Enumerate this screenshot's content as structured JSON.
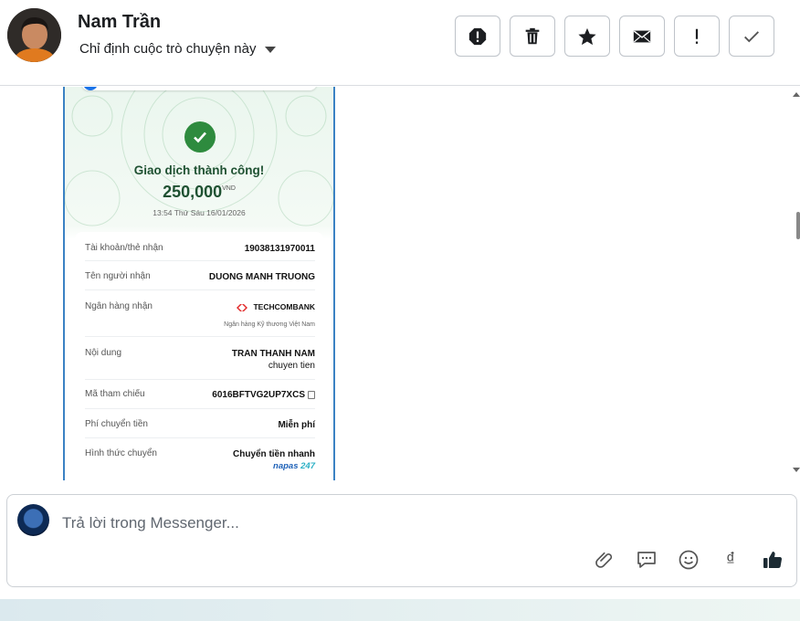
{
  "header": {
    "contact_name": "Nam Trần",
    "assign_label": "Chỉ định cuộc trò chuyện này",
    "toolbar": [
      {
        "icon": "exclamation-circle-icon"
      },
      {
        "icon": "trash-icon"
      },
      {
        "icon": "star-icon"
      },
      {
        "icon": "envelope-icon"
      },
      {
        "icon": "exclamation-icon"
      },
      {
        "icon": "check-icon"
      }
    ]
  },
  "receipt": {
    "success_text": "Giao dịch thành công!",
    "amount": "250,000",
    "currency": "VND",
    "datetime": "13:54 Thứ Sáu 16/01/2026",
    "rows": {
      "account_label": "Tài khoản/thẻ nhận",
      "account_value": "19038131970011",
      "recipient_label": "Tên người nhận",
      "recipient_value": "DUONG MANH TRUONG",
      "bank_label": "Ngân hàng nhận",
      "bank_value": "TECHCOMBANK",
      "bank_sub": "Ngân hàng Kỹ thương Việt Nam",
      "content_label": "Nội dung",
      "content_line1": "TRAN THANH NAM",
      "content_line2": "chuyen tien",
      "ref_label": "Mã tham chiếu",
      "ref_value": "6016BFTVG2UP7XCS",
      "fee_label": "Phí chuyển tiền",
      "fee_value": "Miễn phí",
      "method_label": "Hình thức chuyển",
      "method_value": "Chuyển tiền nhanh",
      "napas_a": "napas",
      "napas_b": "247"
    }
  },
  "composer": {
    "placeholder": "Trả lời trong Messenger...",
    "currency_symbol": "₫",
    "actions": [
      "paperclip-icon",
      "saved-reply-icon",
      "emoji-icon",
      "currency-icon",
      "thumbs-up-icon"
    ]
  },
  "colors": {
    "success_green": "#2e8b3e",
    "receipt_border": "#3b82c4",
    "text_dark": "#1c1e21"
  }
}
